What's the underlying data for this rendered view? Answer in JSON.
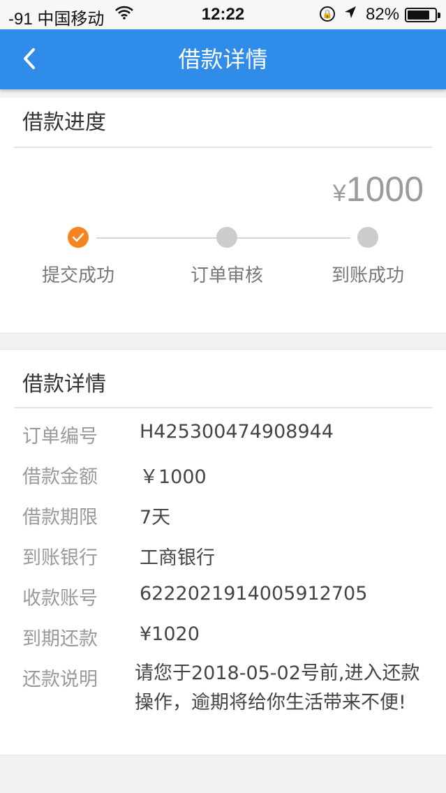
{
  "status_bar": {
    "carrier": "-91 中国移动",
    "time": "12:22",
    "battery_percent": "82%",
    "battery_level": 0.82
  },
  "nav": {
    "title": "借款详情",
    "back_icon": "chevron-left-icon"
  },
  "progress": {
    "section_title": "借款进度",
    "amount_currency": "¥",
    "amount_value": "1000",
    "steps": [
      {
        "label": "提交成功",
        "status": "done"
      },
      {
        "label": "订单审核",
        "status": "pending"
      },
      {
        "label": "到账成功",
        "status": "pending"
      }
    ]
  },
  "details": {
    "section_title": "借款详情",
    "rows": [
      {
        "label": "订单编号",
        "value": "H425300474908944"
      },
      {
        "label": "借款金额",
        "value": "￥1000"
      },
      {
        "label": "借款期限",
        "value": "7天"
      },
      {
        "label": "到账银行",
        "value": "工商银行"
      },
      {
        "label": "收款账号",
        "value": "6222021914005912705"
      },
      {
        "label": "到期还款",
        "value": "¥1020"
      }
    ],
    "note": {
      "label": "还款说明",
      "value": "请您于2018-05-02号前,进入还款操作，逾期将给你生活带来不便!"
    }
  },
  "colors": {
    "nav_background": "#2f8ce8",
    "step_done": "#f5831f",
    "step_pending": "#cccccc",
    "page_background": "#f2f2f2"
  }
}
